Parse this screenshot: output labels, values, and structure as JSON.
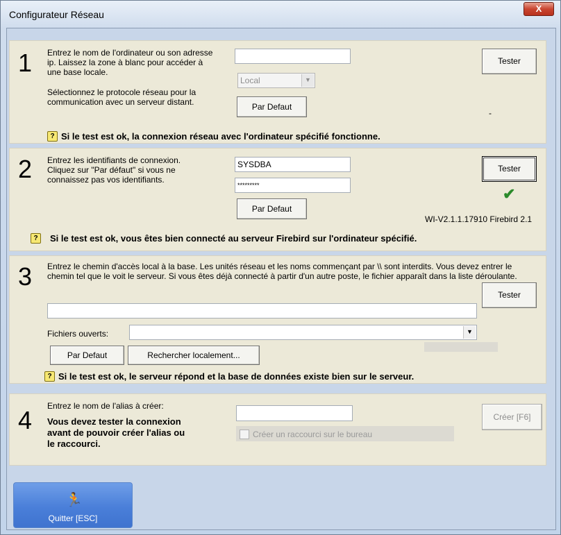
{
  "window": {
    "title": "Configurateur Réseau",
    "close_symbol": "X"
  },
  "section1": {
    "number": "1",
    "description": "Entrez le nom de l'ordinateur ou son adresse ip. Laissez la zone à blanc pour accéder à une base locale.",
    "protocol_description": "Sélectionnez le protocole réseau pour la communication avec un serveur distant.",
    "host_value": "",
    "protocol_value": "Local",
    "default_button": "Par Defaut",
    "test_button": "Tester",
    "status_text": "-",
    "hint": "Si le test est ok, la connexion réseau avec l'ordinateur spécifié fonctionne."
  },
  "section2": {
    "number": "2",
    "description": "Entrez les identifiants de connexion. Cliquez sur \"Par défaut\" si vous ne connaissez pas vos identifiants.",
    "user_value": "SYSDBA",
    "password_value": "*********",
    "default_button": "Par Defaut",
    "test_button": "Tester",
    "version_text": "WI-V2.1.1.17910 Firebird 2.1",
    "hint": "Si le test est ok, vous êtes bien connecté au serveur Firebird sur l'ordinateur spécifié."
  },
  "section3": {
    "number": "3",
    "description": "Entrez le chemin d'accès local à la base. Les unités réseau et les noms commençant par \\\\ sont interdits. Vous devez entrer le chemin tel que le voit le serveur. Si vous êtes déjà connecté à partir d'un autre poste, le fichier apparaît dans la liste déroulante.",
    "path_value": "",
    "open_files_label": "Fichiers ouverts:",
    "open_files_value": "",
    "default_button": "Par Defaut",
    "browse_button": "Rechercher localement...",
    "test_button": "Tester",
    "hint": "Si le test est ok, le serveur répond et la base de données existe bien sur le serveur."
  },
  "section4": {
    "number": "4",
    "description": "Entrez le nom de l'alias à créer:",
    "warning": "Vous devez tester la connexion avant de pouvoir créer l'alias ou le raccourci.",
    "alias_value": "",
    "create_button": "Créer [F6]",
    "shortcut_label": "Créer un raccourci sur le bureau"
  },
  "footer": {
    "quit_button": "Quitter [ESC]"
  },
  "colors": {
    "panel": "#ece9d8",
    "client": "#c8d6e9",
    "quit_button": "#4a7fd9",
    "check": "#2b8a2b"
  }
}
